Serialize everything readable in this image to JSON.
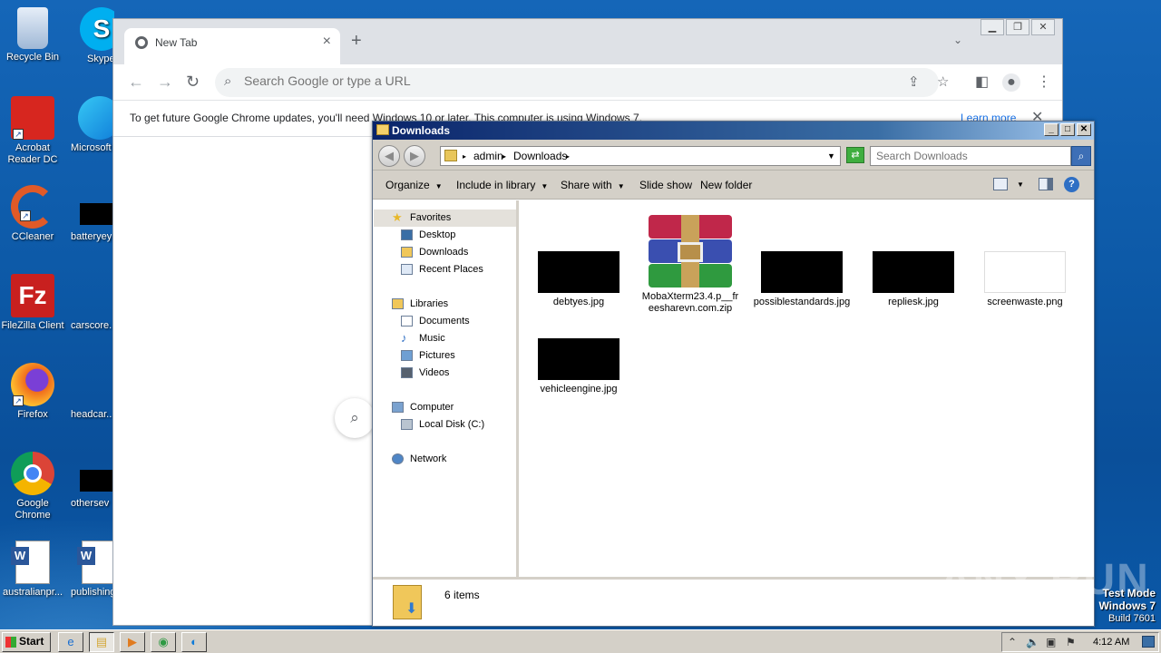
{
  "desktop": {
    "icons_col1": [
      {
        "label": "Recycle Bin",
        "icon": "recycle-bin-icon",
        "color": "#bcd4ee"
      },
      {
        "label": "Acrobat Reader DC",
        "icon": "acrobat-icon",
        "color": "#d7261f"
      },
      {
        "label": "CCleaner",
        "icon": "ccleaner-icon",
        "color": "#e05a28"
      },
      {
        "label": "FileZilla Client",
        "icon": "filezilla-icon",
        "color": "#c8201f"
      },
      {
        "label": "Firefox",
        "icon": "firefox-icon",
        "color": "#f06e1c"
      },
      {
        "label": "Google Chrome",
        "icon": "chrome-icon",
        "color": "#2f9a44"
      },
      {
        "label": "australianpr...",
        "icon": "word-doc-icon",
        "color": "#2b579a"
      }
    ],
    "icons_col2": [
      {
        "label": "Skype",
        "icon": "skype-icon",
        "color": "#00aff0"
      },
      {
        "label": "Microsoft",
        "icon": "edge-icon",
        "color": "#0f7bd8"
      },
      {
        "label": "batteryey",
        "icon": "black-thumb-icon",
        "color": "#000000"
      },
      {
        "label": "carscore...",
        "icon": "blank-icon",
        "color": "#0b5aa9"
      },
      {
        "label": "headcar...",
        "icon": "blank-icon",
        "color": "#0b5aa9"
      },
      {
        "label": "othersev",
        "icon": "black-thumb-icon",
        "color": "#000000"
      },
      {
        "label": "publishing",
        "icon": "word-doc-icon",
        "color": "#2b579a"
      }
    ]
  },
  "chrome": {
    "tab_title": "New Tab",
    "omnibox_placeholder": "Search Google or type a URL",
    "infobar_message": "To get future Google Chrome updates, you'll need Windows 10 or later. This computer is using Windows 7.",
    "infobar_link": "Learn more"
  },
  "explorer": {
    "title": "Downloads",
    "breadcrumb": [
      "admin",
      "Downloads"
    ],
    "search_placeholder": "Search Downloads",
    "commands": {
      "organize": "Organize",
      "include": "Include in library",
      "share": "Share with",
      "slideshow": "Slide show",
      "newfolder": "New folder"
    },
    "nav": {
      "favorites": "Favorites",
      "desktop": "Desktop",
      "downloads": "Downloads",
      "recent": "Recent Places",
      "libraries": "Libraries",
      "documents": "Documents",
      "music": "Music",
      "pictures": "Pictures",
      "videos": "Videos",
      "computer": "Computer",
      "localdisk": "Local Disk (C:)",
      "network": "Network"
    },
    "files": [
      {
        "name": "debtyes.jpg",
        "thumb": "black"
      },
      {
        "name": "MobaXterm23.4.p__freesharevn.com.zip",
        "thumb": "rar"
      },
      {
        "name": "possiblestandards.jpg",
        "thumb": "black"
      },
      {
        "name": "repliesk.jpg",
        "thumb": "black"
      },
      {
        "name": "screenwaste.png",
        "thumb": "white"
      },
      {
        "name": "vehicleengine.jpg",
        "thumb": "black"
      }
    ],
    "status": "6 items"
  },
  "taskbar": {
    "start": "Start",
    "clock": "4:12 AM"
  },
  "watermark": "ANY RUN",
  "test_mode": {
    "line1": "Test Mode",
    "line2": "Windows 7",
    "line3": "Build 7601"
  }
}
